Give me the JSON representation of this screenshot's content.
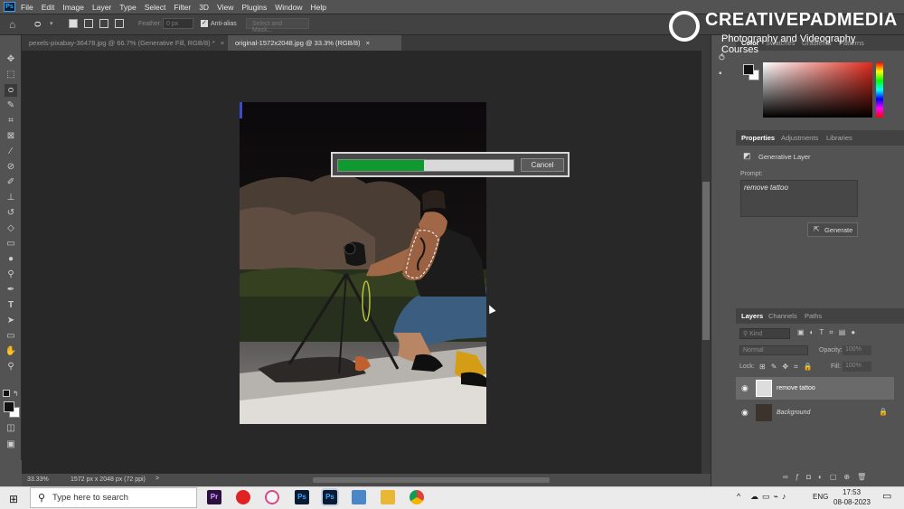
{
  "app": {
    "logo": "Ps",
    "menu": [
      "File",
      "Edit",
      "Image",
      "Layer",
      "Type",
      "Select",
      "Filter",
      "3D",
      "View",
      "Plugins",
      "Window",
      "Help"
    ]
  },
  "options_bar": {
    "feather_label": "Feather:",
    "feather_value": "0 px",
    "anti_alias_label": "Anti-alias",
    "anti_alias_checked": true,
    "select_mask_label": "Select and Mask..."
  },
  "doc_tabs": [
    {
      "label": "pexels-pixabay-36478.jpg @ 66.7% (Generative Fill, RGB/8) *",
      "close": "×"
    },
    {
      "label": "original-1572x2048.jpg @ 33.3% (RGB/8)",
      "close": "×"
    }
  ],
  "progress": {
    "fraction": 0.49,
    "cancel_label": "Cancel"
  },
  "status_bar": {
    "zoom": "33.33%",
    "doc_info": "1572 px x 2048 px (72 ppi)",
    "arrow": ">"
  },
  "watermark": {
    "brand": "CREATIVEPADMEDIA",
    "tagline": "Photography and Videography Courses"
  },
  "color_panel": {
    "tabs": [
      "Color",
      "Swatches",
      "Gradients",
      "Patterns"
    ]
  },
  "properties_panel": {
    "tabs": [
      "Properties",
      "Adjustments",
      "Libraries"
    ],
    "layer_type": "Generative Layer",
    "prompt_label": "Prompt:",
    "prompt_value": "remove tattoo",
    "generate_label": "Generate"
  },
  "layers_panel": {
    "tabs": [
      "Layers",
      "Channels",
      "Paths"
    ],
    "filter_placeholder": "Kind",
    "blend_mode": "Normal",
    "opacity_label": "Opacity:",
    "opacity_value": "100%",
    "lock_label": "Lock:",
    "fill_label": "Fill:",
    "fill_value": "100%",
    "layers": [
      {
        "name": "remove tattoo",
        "selected": true
      },
      {
        "name": "Background",
        "locked": true
      }
    ]
  },
  "taskbar": {
    "search_placeholder": "Type here to search",
    "language": "ENG",
    "time": "17:53",
    "date": "08-08-2023",
    "up_arrow": "^"
  },
  "colors": {
    "accent": "#31a8ff",
    "progress_fill": "#0f9a2f"
  }
}
